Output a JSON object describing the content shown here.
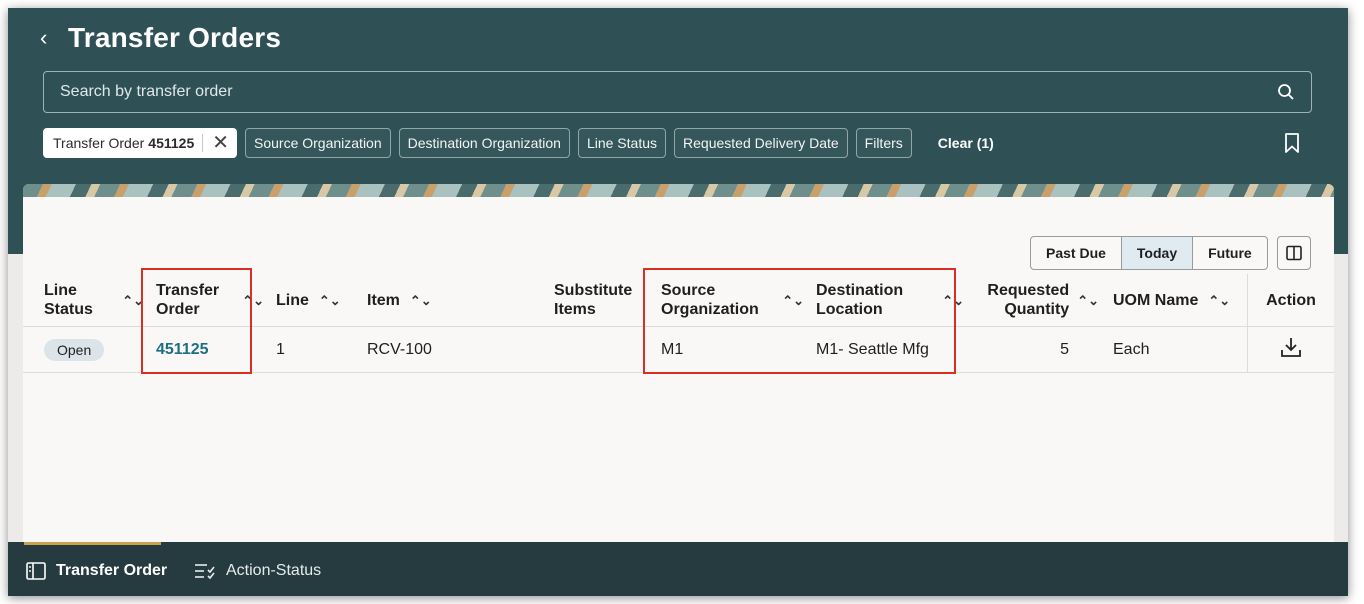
{
  "header": {
    "title": "Transfer Orders",
    "search_placeholder": "Search by transfer order"
  },
  "filters": {
    "active_chip": {
      "label": "Transfer Order",
      "value": "451125"
    },
    "chips": [
      "Source Organization",
      "Destination Organization",
      "Line Status",
      "Requested Delivery Date",
      "Filters"
    ],
    "clear_label": "Clear (1)"
  },
  "time_toggle": {
    "options": [
      "Past Due",
      "Today",
      "Future"
    ],
    "selected": "Today"
  },
  "table": {
    "columns": {
      "line_status": "Line\nStatus",
      "transfer_order": "Transfer\nOrder",
      "line": "Line",
      "item": "Item",
      "substitute_items": "Substitute\nItems",
      "source_organization": "Source\nOrganization",
      "destination_location": "Destination\nLocation",
      "requested_quantity": "Requested\nQuantity",
      "uom_name": "UOM Name",
      "action": "Action"
    },
    "rows": [
      {
        "line_status": "Open",
        "transfer_order": "451125",
        "line": "1",
        "item": "RCV-100",
        "substitute_items": "",
        "source_organization": "M1",
        "destination_location": "M1- Seattle Mfg",
        "requested_quantity": "5",
        "uom_name": "Each"
      }
    ]
  },
  "bottom_tabs": [
    {
      "label": "Transfer Order",
      "icon": "panel-icon",
      "active": true
    },
    {
      "label": "Action-Status",
      "icon": "checklist-icon",
      "active": false
    }
  ],
  "colors": {
    "header_bg": "#2f5156",
    "link": "#1d6f84",
    "highlight": "#d93025",
    "tab_indicator": "#c9a04e"
  }
}
